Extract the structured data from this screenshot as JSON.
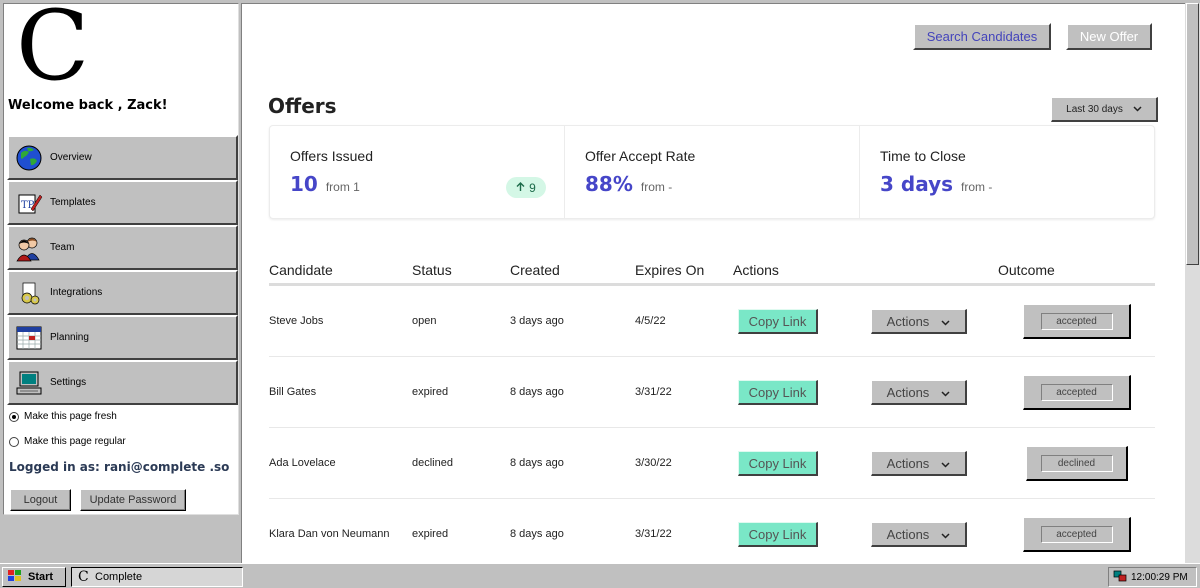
{
  "sidebar": {
    "logo": "C",
    "welcome": "Welcome back , Zack!",
    "nav": [
      {
        "label": "Overview",
        "icon": "globe-icon"
      },
      {
        "label": "Templates",
        "icon": "document-pen-icon"
      },
      {
        "label": "Team",
        "icon": "people-icon"
      },
      {
        "label": "Integrations",
        "icon": "puzzle-gears-icon"
      },
      {
        "label": "Planning",
        "icon": "calendar-icon"
      },
      {
        "label": "Settings",
        "icon": "computer-icon"
      }
    ],
    "radios": [
      {
        "label": "Make this page fresh",
        "checked": true
      },
      {
        "label": "Make this page regular",
        "checked": false
      }
    ],
    "logged_in": "Logged in as: rani@complete .so",
    "logout_label": "Logout",
    "update_password_label": "Update Password"
  },
  "header": {
    "search_label": "Search Candidates",
    "new_offer_label": "New Offer",
    "title": "Offers",
    "range_label": "Last 30 days"
  },
  "stats": [
    {
      "label": "Offers Issued",
      "value": "10",
      "from": "from 1",
      "delta": "9"
    },
    {
      "label": "Offer Accept Rate",
      "value": "88%",
      "from": "from -"
    },
    {
      "label": "Time to Close",
      "value": "3 days",
      "from": "from -"
    }
  ],
  "table": {
    "columns": [
      "Candidate",
      "Status",
      "Created",
      "Expires On",
      "Actions",
      "Outcome"
    ],
    "copy_label": "Copy Link",
    "actions_label": "Actions",
    "rows": [
      {
        "candidate": "Steve Jobs",
        "status": "open",
        "created": "3 days ago",
        "expires": "4/5/22",
        "outcome": "accepted"
      },
      {
        "candidate": "Bill Gates",
        "status": "expired",
        "created": "8 days ago",
        "expires": "3/31/22",
        "outcome": "accepted"
      },
      {
        "candidate": "Ada Lovelace",
        "status": "declined",
        "created": "8 days ago",
        "expires": "3/30/22",
        "outcome": "declined"
      },
      {
        "candidate": "Klara Dan von Neumann",
        "status": "expired",
        "created": "8 days ago",
        "expires": "3/31/22",
        "outcome": "accepted"
      }
    ]
  },
  "taskbar": {
    "start_label": "Start",
    "task_label": "Complete",
    "clock": "12:00:29 PM"
  },
  "colors": {
    "accent": "#4646c8",
    "copy_button": "#7ae7c7",
    "delta_badge": "#d4f7e6",
    "win_face": "#c0c0c0"
  }
}
